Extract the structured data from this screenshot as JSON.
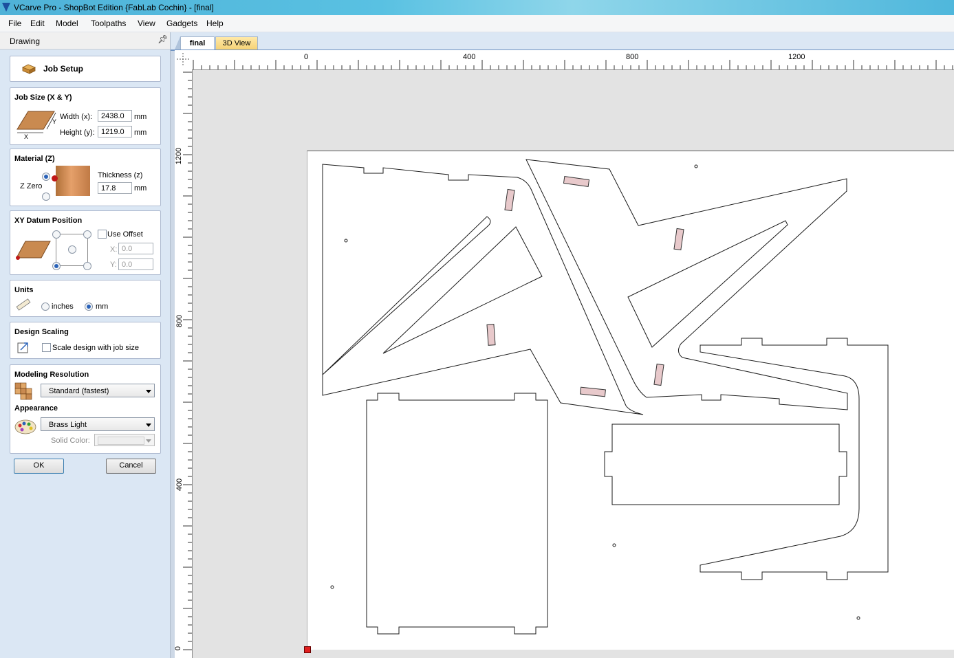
{
  "window": {
    "title": "VCarve Pro - ShopBot Edition {FabLab Cochin} - [final]"
  },
  "menu": [
    {
      "label": "File"
    },
    {
      "label": "Edit"
    },
    {
      "label": "Model"
    },
    {
      "label": "Toolpaths"
    },
    {
      "label": "View"
    },
    {
      "label": "Gadgets"
    },
    {
      "label": "Help"
    }
  ],
  "panel": {
    "title": "Drawing",
    "job_setup": {
      "label": "Job Setup"
    },
    "job_size": {
      "heading": "Job Size (X & Y)",
      "width_label": "Width (x):",
      "width_value": "2438.0",
      "height_label": "Height (y):",
      "height_value": "1219.0",
      "unit": "mm",
      "axis_x": "X",
      "axis_y": "Y"
    },
    "material": {
      "heading": "Material (Z)",
      "zzero_label": "Z Zero",
      "thickness_label": "Thickness (z)",
      "thickness_value": "17.8",
      "unit": "mm",
      "top_selected": true
    },
    "datum": {
      "heading": "XY Datum Position",
      "use_offset_label": "Use Offset",
      "use_offset_checked": false,
      "x_label": "X:",
      "x_value": "0.0",
      "y_label": "Y:",
      "y_value": "0.0",
      "selected_corner": "bottom-left"
    },
    "units": {
      "heading": "Units",
      "inches_label": "inches",
      "mm_label": "mm",
      "selected": "mm"
    },
    "scaling": {
      "heading": "Design Scaling",
      "scale_label": "Scale design with job size",
      "checked": false
    },
    "resolution": {
      "heading": "Modeling Resolution",
      "value": "Standard (fastest)"
    },
    "appearance": {
      "heading": "Appearance",
      "value": "Brass Light",
      "solid_color_label": "Solid Color:"
    },
    "ok_label": "OK",
    "cancel_label": "Cancel"
  },
  "tabs": [
    {
      "label": "final",
      "active": true
    },
    {
      "label": "3D View",
      "active": false
    }
  ],
  "ruler_top_labels": [
    "0",
    "400",
    "800",
    "1200"
  ],
  "ruler_left_labels": [
    "1200",
    "800",
    "400",
    "0"
  ],
  "colors": {
    "accent": "#2a62b8",
    "sheet": "#ffffff",
    "workspace": "#e3e3e3",
    "origin_marker": "#e02020",
    "vector": "#1a1a1a",
    "toolpath_tab": "#e8c9cb"
  }
}
